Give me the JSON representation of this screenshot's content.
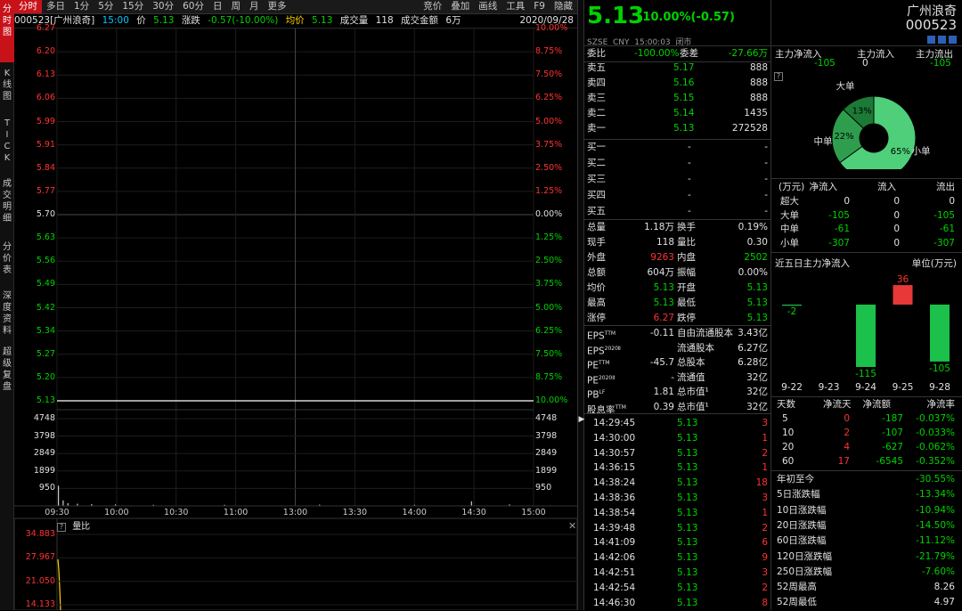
{
  "left_tabs": [
    "分时图",
    "K线图",
    "TICK",
    "成交明细",
    "分价表",
    "深度资料",
    "超级复盘"
  ],
  "toolbar": {
    "periods": [
      "分时",
      "多日",
      "1分",
      "5分",
      "15分",
      "30分",
      "60分",
      "日",
      "周",
      "月",
      "更多"
    ],
    "tools": [
      "竞价",
      "叠加",
      "画线",
      "工具",
      "F9",
      "隐藏"
    ]
  },
  "infobar": {
    "code_name": "000523[广州浪奇]",
    "time": "15:00",
    "price_label": "价",
    "price": "5.13",
    "change_label": "涨跌",
    "change": "-0.57(-10.00%)",
    "avg_label": "均价",
    "avg": "5.13",
    "vol_label": "成交量",
    "vol": "118",
    "amount_label": "成交金额",
    "amount": "6万",
    "date": "2020/09/28"
  },
  "chart_data": {
    "type": "line",
    "title": "",
    "x_ticks": [
      "09:30",
      "10:00",
      "10:30",
      "11:00",
      "13:00",
      "13:30",
      "14:00",
      "14:30",
      "15:00"
    ],
    "price_ticks": [
      "6.27",
      "6.20",
      "6.13",
      "6.06",
      "5.99",
      "5.91",
      "5.84",
      "5.77",
      "5.70",
      "5.63",
      "5.56",
      "5.49",
      "5.42",
      "5.34",
      "5.27",
      "5.20",
      "5.13"
    ],
    "pct_ticks": [
      "10.00%",
      "8.75%",
      "7.50%",
      "6.25%",
      "5.00%",
      "3.75%",
      "2.50%",
      "1.25%",
      "0.00%",
      "1.25%",
      "2.50%",
      "3.75%",
      "5.00%",
      "6.25%",
      "7.50%",
      "8.75%",
      "10.00%"
    ],
    "ylim": [
      5.13,
      6.27
    ],
    "prev_close": 5.7,
    "series": [
      {
        "values": [
          5.13,
          5.13,
          5.13,
          5.13,
          5.13,
          5.13,
          5.13,
          5.13,
          5.13
        ]
      }
    ],
    "volume_ticks": [
      "4748",
      "3798",
      "2849",
      "1899",
      "950"
    ],
    "volume_ylim": [
      0,
      4748
    ],
    "volume_bars": [
      {
        "t": 0.0,
        "v": 1100
      },
      {
        "t": 0.01,
        "v": 300
      },
      {
        "t": 0.02,
        "v": 150
      },
      {
        "t": 0.04,
        "v": 120
      },
      {
        "t": 0.07,
        "v": 100
      },
      {
        "t": 0.12,
        "v": 80
      },
      {
        "t": 0.2,
        "v": 60
      },
      {
        "t": 0.35,
        "v": 60
      },
      {
        "t": 0.55,
        "v": 70
      },
      {
        "t": 0.75,
        "v": 60
      },
      {
        "t": 0.87,
        "v": 250
      },
      {
        "t": 0.95,
        "v": 80
      }
    ],
    "ratio_label": "量比",
    "ratio_ticks": [
      "34.883",
      "27.967",
      "21.050",
      "14.133"
    ]
  },
  "quote": {
    "price": "5.13",
    "change": "-10.00%(-0.57)",
    "name": "广州浪奇",
    "code": "000523",
    "market_line": "SZSE  CNY  15:00:03  闭市",
    "weibi_label": "委比",
    "weibi": "-100.00%",
    "weicha_label": "委差",
    "weicha": "-27.66万",
    "asks": [
      {
        "label": "卖五",
        "price": "5.17",
        "vol": "888"
      },
      {
        "label": "卖四",
        "price": "5.16",
        "vol": "888"
      },
      {
        "label": "卖三",
        "price": "5.15",
        "vol": "888"
      },
      {
        "label": "卖二",
        "price": "5.14",
        "vol": "1435"
      },
      {
        "label": "卖一",
        "price": "5.13",
        "vol": "272528"
      }
    ],
    "bids": [
      {
        "label": "买一",
        "price": "-",
        "vol": "-"
      },
      {
        "label": "买二",
        "price": "-",
        "vol": "-"
      },
      {
        "label": "买三",
        "price": "-",
        "vol": "-"
      },
      {
        "label": "买四",
        "price": "-",
        "vol": "-"
      },
      {
        "label": "买五",
        "price": "-",
        "vol": "-"
      }
    ],
    "stats": [
      {
        "l1": "总量",
        "v1": "1.18万",
        "c1": "w",
        "l2": "换手",
        "v2": "0.19%",
        "c2": "w"
      },
      {
        "l1": "现手",
        "v1": "118",
        "c1": "w",
        "l2": "量比",
        "v2": "0.30",
        "c2": "w"
      },
      {
        "l1": "外盘",
        "v1": "9263",
        "c1": "r",
        "l2": "内盘",
        "v2": "2502",
        "c2": "g"
      },
      {
        "l1": "总额",
        "v1": "604万",
        "c1": "w",
        "l2": "振幅",
        "v2": "0.00%",
        "c2": "w"
      },
      {
        "l1": "均价",
        "v1": "5.13",
        "c1": "g",
        "l2": "开盘",
        "v2": "5.13",
        "c2": "g"
      },
      {
        "l1": "最高",
        "v1": "5.13",
        "c1": "g",
        "l2": "最低",
        "v2": "5.13",
        "c2": "g"
      },
      {
        "l1": "涨停",
        "v1": "6.27",
        "c1": "r",
        "l2": "跌停",
        "v2": "5.13",
        "c2": "g"
      }
    ],
    "fin": [
      {
        "l1": "EPS",
        "s1": "TTM",
        "v1": "-0.11",
        "l2": "自由流通股本",
        "v2": "3.43亿"
      },
      {
        "l1": "EPS",
        "s1": "2020Ⅱ",
        "v1": "",
        "l2": "流通股本",
        "v2": "6.27亿"
      },
      {
        "l1": "PE",
        "s1": "TTM",
        "v1": "-45.7",
        "l2": "总股本",
        "v2": "6.28亿"
      },
      {
        "l1": "PE",
        "s1": "2020Ⅱ",
        "v1": "-",
        "l2": "流通值",
        "v2": "32亿"
      },
      {
        "l1": "PB",
        "s1": "LF",
        "v1": "1.81",
        "l2": "总市值¹",
        "v2": "32亿"
      },
      {
        "l1": "股息率",
        "s1": "TTM",
        "v1": "0.39",
        "l2": "总市值¹",
        "v2": "32亿"
      }
    ],
    "ticks": [
      {
        "time": "14:29:45",
        "price": "5.13",
        "vol": "3"
      },
      {
        "time": "14:30:00",
        "price": "5.13",
        "vol": "1"
      },
      {
        "time": "14:30:57",
        "price": "5.13",
        "vol": "2"
      },
      {
        "time": "14:36:15",
        "price": "5.13",
        "vol": "1"
      },
      {
        "time": "14:38:24",
        "price": "5.13",
        "vol": "18"
      },
      {
        "time": "14:38:36",
        "price": "5.13",
        "vol": "3"
      },
      {
        "time": "14:38:54",
        "price": "5.13",
        "vol": "1"
      },
      {
        "time": "14:39:48",
        "price": "5.13",
        "vol": "2"
      },
      {
        "time": "14:41:09",
        "price": "5.13",
        "vol": "6"
      },
      {
        "time": "14:42:06",
        "price": "5.13",
        "vol": "9"
      },
      {
        "time": "14:42:51",
        "price": "5.13",
        "vol": "3"
      },
      {
        "time": "14:42:54",
        "price": "5.13",
        "vol": "2"
      },
      {
        "time": "14:46:30",
        "price": "5.13",
        "vol": "8"
      }
    ]
  },
  "capital": {
    "head": [
      "主力净流入",
      "主力流入",
      "主力流出"
    ],
    "vals": [
      "-105",
      "0",
      "-105"
    ],
    "pie_labels": [
      "大单",
      "中单",
      "小单"
    ],
    "pie": [
      {
        "name": "大单",
        "pct": 22,
        "label": "22%",
        "color": "#2e9e4e"
      },
      {
        "name": "中单",
        "pct": 13,
        "label": "13%",
        "color": "#1c7a36"
      },
      {
        "name": "小单",
        "pct": 65,
        "label": "65%",
        "color": "#4fcf7a"
      }
    ],
    "table_head": [
      "(万元)",
      "净流入",
      "流入",
      "流出"
    ],
    "table": [
      {
        "name": "超大",
        "net": "0",
        "in": "0",
        "out": "0",
        "nc": "w",
        "oc": "w"
      },
      {
        "name": "大单",
        "net": "-105",
        "in": "0",
        "out": "-105",
        "nc": "g",
        "oc": "g"
      },
      {
        "name": "中单",
        "net": "-61",
        "in": "0",
        "out": "-61",
        "nc": "g",
        "oc": "g"
      },
      {
        "name": "小单",
        "net": "-307",
        "in": "0",
        "out": "-307",
        "nc": "g",
        "oc": "g"
      }
    ],
    "five_title": "近五日主力净流入",
    "five_unit": "单位(万元)",
    "five": {
      "categories": [
        "9-22",
        "9-23",
        "9-24",
        "9-25",
        "9-28"
      ],
      "values": [
        -2,
        0,
        -115,
        36,
        -105
      ],
      "labels": [
        "-2",
        "",
        "-115",
        "36",
        "-105"
      ]
    },
    "days_head": [
      "天数",
      "净流天",
      "净流额",
      "净流率"
    ],
    "days": [
      {
        "d": "5",
        "n": "0",
        "amt": "-187",
        "rate": "-0.037%",
        "nc": "r"
      },
      {
        "d": "10",
        "n": "2",
        "amt": "-107",
        "rate": "-0.033%",
        "nc": "r"
      },
      {
        "d": "20",
        "n": "4",
        "amt": "-627",
        "rate": "-0.062%",
        "nc": "r"
      },
      {
        "d": "60",
        "n": "17",
        "amt": "-6545",
        "rate": "-0.352%",
        "nc": "r"
      }
    ],
    "perf": [
      {
        "label": "年初至今",
        "val": "-30.55%",
        "c": "g"
      },
      {
        "label": "5日涨跌幅",
        "val": "-13.34%",
        "c": "g"
      },
      {
        "label": "10日涨跌幅",
        "val": "-10.94%",
        "c": "g"
      },
      {
        "label": "20日涨跌幅",
        "val": "-14.50%",
        "c": "g"
      },
      {
        "label": "60日涨跌幅",
        "val": "-11.12%",
        "c": "g"
      },
      {
        "label": "120日涨跌幅",
        "val": "-21.79%",
        "c": "g"
      },
      {
        "label": "250日涨跌幅",
        "val": "-7.60%",
        "c": "g"
      },
      {
        "label": "52周最高",
        "val": "8.26",
        "c": "w"
      },
      {
        "label": "52周最低",
        "val": "4.97",
        "c": "w"
      }
    ]
  }
}
